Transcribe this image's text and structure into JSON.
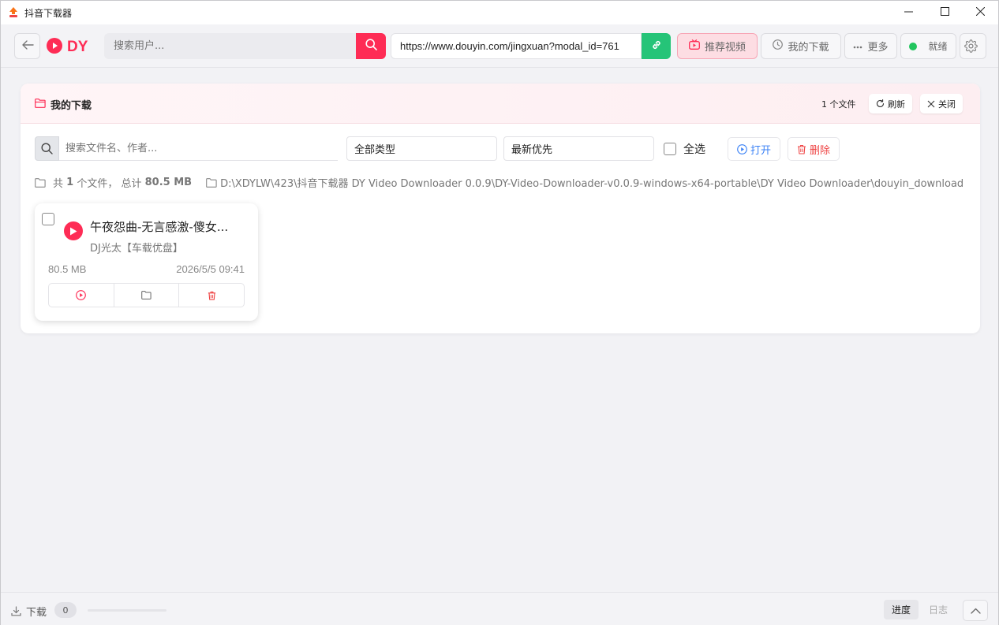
{
  "window": {
    "title": "抖音下载器"
  },
  "toolbar": {
    "logo_text": "DY",
    "search_placeholder": "搜索用户...",
    "url_value": "https://www.douyin.com/jingxuan?modal_id=761",
    "recommend_label": "推荐视频",
    "my_downloads_label": "我的下载",
    "more_label": "更多",
    "status_label": "就绪"
  },
  "panel": {
    "title": "我的下载",
    "file_count": "1 个文件",
    "refresh_label": "刷新",
    "close_label": "关闭",
    "search_placeholder": "搜索文件名、作者...",
    "type_filter": "全部类型",
    "sort_filter": "最新优先",
    "select_all_label": "全选",
    "open_label": "打开",
    "delete_label": "删除",
    "summary_prefix": "共",
    "summary_count": "1",
    "summary_mid": "个文件，  总计",
    "summary_total": "80.5 MB",
    "path": "D:\\XDYLW\\423\\抖音下载器 DY Video Downloader 0.0.9\\DY-Video-Downloader-v0.0.9-windows-x64-portable\\DY Video Downloader\\douyin_download"
  },
  "files": [
    {
      "title": "午夜怨曲-无言感激-傻女...",
      "author": "DJ光太【车载优盘】",
      "size": "80.5 MB",
      "date": "2026/5/5 09:41"
    }
  ],
  "bottom": {
    "download_label": "下载",
    "download_count": "0",
    "download_progress": 0,
    "tab_progress": "进度",
    "tab_log": "日志"
  },
  "colors": {
    "brand": "#fe2c55",
    "link_green": "#25c478",
    "status_green": "#22c55e",
    "open_blue": "#3b82f6",
    "delete_red": "#ef4444"
  }
}
